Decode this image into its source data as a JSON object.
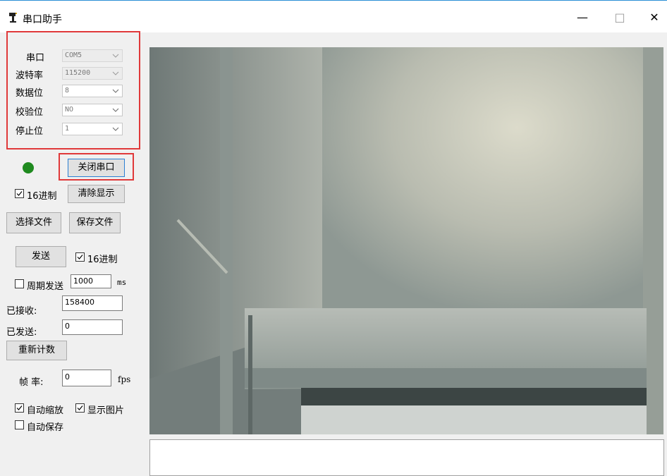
{
  "window": {
    "title": "串口助手",
    "min_glyph": "—",
    "max_glyph": "□",
    "close_glyph": "✕"
  },
  "serial_settings": {
    "port_label": "串口",
    "port_value": "COM5",
    "baud_label": "波特率",
    "baud_value": "115200",
    "databits_label": "数据位",
    "databits_value": "8",
    "parity_label": "校验位",
    "parity_value": "NO",
    "stopbits_label": "停止位",
    "stopbits_value": "1"
  },
  "connection": {
    "status_color": "#1f8a1f",
    "close_port_label": "关闭串口"
  },
  "receive_options": {
    "hex_label": "16进制",
    "hex_checked": true,
    "clear_label": "清除显示"
  },
  "file": {
    "select_label": "选择文件",
    "save_label": "保存文件"
  },
  "send": {
    "send_label": "发送",
    "hex_label": "16进制",
    "hex_checked": true,
    "periodic_label": "周期发送",
    "periodic_checked": false,
    "period_value": "1000",
    "period_unit": "ms"
  },
  "counters": {
    "received_label": "已接收:",
    "received_value": "158400",
    "sent_label": "已发送:",
    "sent_value": "0",
    "reset_label": "重新计数",
    "fps_label": "帧 率:",
    "fps_value": "0",
    "fps_unit": "fps"
  },
  "display_options": {
    "autoscale_label": "自动缩放",
    "autoscale_checked": true,
    "show_image_label": "显示图片",
    "show_image_checked": true,
    "autosave_label": "自动保存",
    "autosave_checked": false
  },
  "icons": [
    "app-icon",
    "chevron-down-icon",
    "checkmark-icon"
  ],
  "colors": {
    "highlight_box": "#e0393a",
    "focus_border": "#2c7fd3"
  }
}
